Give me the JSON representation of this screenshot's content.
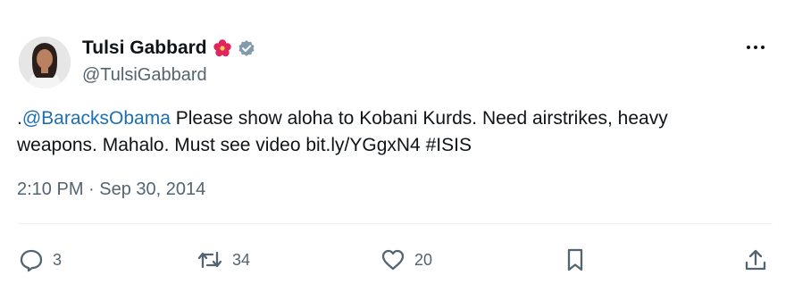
{
  "tweet": {
    "author_name": "Tulsi Gabbard",
    "author_handle": "@TulsiGabbard",
    "mention": "@BaracksObama",
    "text_before": ".",
    "text_after": " Please show aloha to Kobani Kurds. Need airstrikes, heavy weapons. Mahalo. Must see video ",
    "link": "bit.ly/YGgxN4",
    "hashtag": "#ISIS",
    "timestamp": "2:10 PM · Sep 30, 2014"
  },
  "actions": {
    "replies": "3",
    "reposts": "34",
    "likes": "20"
  },
  "icons": {
    "flower": "hibiscus-icon",
    "verified": "verified-badge-icon",
    "more": "more-options-icon",
    "reply": "reply-icon",
    "repost": "repost-icon",
    "like": "heart-icon",
    "bookmark": "bookmark-icon",
    "share": "share-icon"
  },
  "colors": {
    "link": "#1d6fb3",
    "secondary_text": "#536471",
    "verified": "#829aab"
  }
}
